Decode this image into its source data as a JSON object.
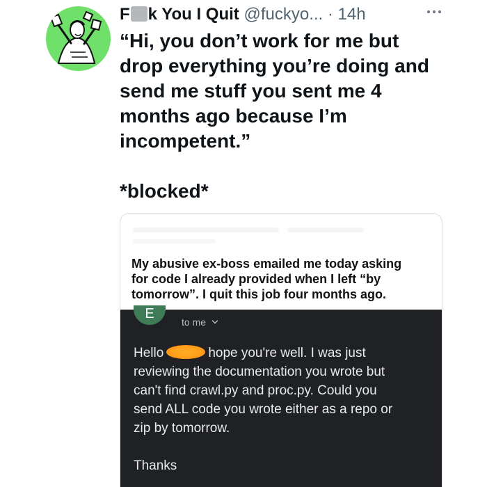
{
  "tweet": {
    "author_name_start": "F",
    "author_name_end": "k You I Quit",
    "handle": "@fuckyo...",
    "separator": "·",
    "time": "14h",
    "more_icon": "more-icon",
    "lines": [
      "“Hi, you don’t work for me but",
      "drop everything you’re doing and",
      "send me stuff you sent me 4",
      "months ago because I’m",
      "incompetent.”"
    ],
    "closing": "*blocked*"
  },
  "quote": {
    "caption_lines": [
      "My abusive ex-boss emailed me today asking",
      "for code I already provided when I left “by",
      "tomorrow”. I quit this job four months ago."
    ]
  },
  "email": {
    "sender_initial": "E",
    "recipient": "to me",
    "chevron_icon": "chevron-down-icon",
    "greeting": "Hello",
    "body_line_1_rest": "hope you're well. I was just",
    "body_lines": [
      "reviewing the documentation you wrote but",
      "can't find crawl.py and proc.py. Could you",
      "send ALL code you wrote either as a repo or",
      "zip by tomorrow."
    ],
    "signoff": "Thanks"
  },
  "colors": {
    "avatar_background": "#6fe06a",
    "email_background": "#202124",
    "email_redaction": "#ff9f1a",
    "sender_avatar": "#3f7b57"
  }
}
